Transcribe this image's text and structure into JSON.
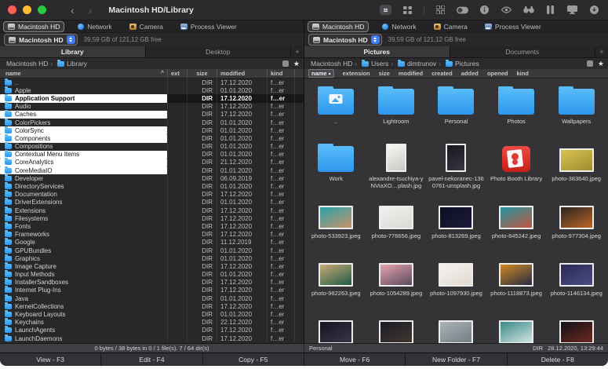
{
  "icons_legend": {
    "back": "‹",
    "forward": "›",
    "star": "★",
    "square": "view-square",
    "sort_caret_left": "^",
    "sort_arrow_right": "▴"
  },
  "colors": {
    "traffic_close": "#ff5f57",
    "traffic_min": "#febc2e",
    "traffic_zoom": "#28c840",
    "folder_blue": "#3da2f2",
    "accent_blue": "#3d7bf7",
    "selection_white": "#ffffff",
    "photobooth_red": "#d92722"
  },
  "titlebar": {
    "title": "Macintosh HD/Library"
  },
  "left_pane": {
    "tabs": [
      {
        "label": "Macintosh HD",
        "icon": "drive",
        "active": true
      },
      {
        "label": "Network",
        "icon": "globe"
      },
      {
        "label": "Camera",
        "icon": "camera"
      },
      {
        "label": "Process Viewer",
        "icon": "gauge"
      }
    ],
    "drive": {
      "name": "Macintosh HD",
      "free": "39,59 GB of 121,12 GB free"
    },
    "folder_tabs": [
      {
        "label": "Library",
        "active": true
      },
      {
        "label": "Desktop"
      }
    ],
    "add_tab_label": "+",
    "path": [
      {
        "label": "Macintosh HD",
        "icon": "drive"
      },
      {
        "label": "Library",
        "icon": "folder"
      }
    ],
    "columns": {
      "name": "name",
      "ext": "ext",
      "size": "size",
      "modified": "modified",
      "kind": "kind"
    },
    "sort_indicator": "^",
    "files": [
      {
        "name": "..",
        "ext": "",
        "size": "DIR",
        "modified": "17.12.2020",
        "kind": "f…er"
      },
      {
        "name": "Apple",
        "ext": "",
        "size": "DIR",
        "modified": "01.01.2020",
        "kind": "f…er"
      },
      {
        "name": "Application Support",
        "ext": "",
        "size": "DIR",
        "modified": "17.12.2020",
        "kind": "f…er",
        "selected": true,
        "cursor": true
      },
      {
        "name": "Audio",
        "ext": "",
        "size": "DIR",
        "modified": "17.12.2020",
        "kind": "f…er"
      },
      {
        "name": "Caches",
        "ext": "",
        "size": "DIR",
        "modified": "17.12.2020",
        "kind": "f…er",
        "selected": true
      },
      {
        "name": "ColorPickers",
        "ext": "",
        "size": "DIR",
        "modified": "01.01.2020",
        "kind": "f…er"
      },
      {
        "name": "ColorSync",
        "ext": "",
        "size": "DIR",
        "modified": "01.01.2020",
        "kind": "f…er",
        "selected": true
      },
      {
        "name": "Components",
        "ext": "",
        "size": "DIR",
        "modified": "01.01.2020",
        "kind": "f…er",
        "selected": true
      },
      {
        "name": "Compositions",
        "ext": "",
        "size": "DIR",
        "modified": "01.01.2020",
        "kind": "f…er"
      },
      {
        "name": "Contextual Menu Items",
        "ext": "",
        "size": "DIR",
        "modified": "01.01.2020",
        "kind": "f…er",
        "selected": true
      },
      {
        "name": "CoreAnalytics",
        "ext": "",
        "size": "DIR",
        "modified": "21.12.2020",
        "kind": "f…er",
        "selected": true
      },
      {
        "name": "CoreMediaIO",
        "ext": "",
        "size": "DIR",
        "modified": "01.01.2020",
        "kind": "f…er",
        "selected": true
      },
      {
        "name": "Developer",
        "ext": "",
        "size": "DIR",
        "modified": "06.09.2019",
        "kind": "f…er"
      },
      {
        "name": "DirectoryServices",
        "ext": "",
        "size": "DIR",
        "modified": "01.01.2020",
        "kind": "f…er"
      },
      {
        "name": "Documentation",
        "ext": "",
        "size": "DIR",
        "modified": "17.12.2020",
        "kind": "f…er"
      },
      {
        "name": "DriverExtensions",
        "ext": "",
        "size": "DIR",
        "modified": "01.01.2020",
        "kind": "f…er"
      },
      {
        "name": "Extensions",
        "ext": "",
        "size": "DIR",
        "modified": "17.12.2020",
        "kind": "f…er"
      },
      {
        "name": "Filesystems",
        "ext": "",
        "size": "DIR",
        "modified": "17.12.2020",
        "kind": "f…er"
      },
      {
        "name": "Fonts",
        "ext": "",
        "size": "DIR",
        "modified": "17.12.2020",
        "kind": "f…er"
      },
      {
        "name": "Frameworks",
        "ext": "",
        "size": "DIR",
        "modified": "17.12.2020",
        "kind": "f…er"
      },
      {
        "name": "Google",
        "ext": "",
        "size": "DIR",
        "modified": "11.12.2019",
        "kind": "f…er"
      },
      {
        "name": "GPUBundles",
        "ext": "",
        "size": "DIR",
        "modified": "01.01.2020",
        "kind": "f…er"
      },
      {
        "name": "Graphics",
        "ext": "",
        "size": "DIR",
        "modified": "01.01.2020",
        "kind": "f…er"
      },
      {
        "name": "Image Capture",
        "ext": "",
        "size": "DIR",
        "modified": "17.12.2020",
        "kind": "f…er"
      },
      {
        "name": "Input Methods",
        "ext": "",
        "size": "DIR",
        "modified": "01.01.2020",
        "kind": "f…er"
      },
      {
        "name": "InstallerSandboxes",
        "ext": "",
        "size": "DIR",
        "modified": "17.12.2020",
        "kind": "f…er"
      },
      {
        "name": "Internet Plug-Ins",
        "ext": "",
        "size": "DIR",
        "modified": "17.12.2020",
        "kind": "f…er"
      },
      {
        "name": "Java",
        "ext": "",
        "size": "DIR",
        "modified": "01.01.2020",
        "kind": "f…er"
      },
      {
        "name": "KernelCollections",
        "ext": "",
        "size": "DIR",
        "modified": "17.12.2020",
        "kind": "f…er"
      },
      {
        "name": "Keyboard Layouts",
        "ext": "",
        "size": "DIR",
        "modified": "01.01.2020",
        "kind": "f…er"
      },
      {
        "name": "Keychains",
        "ext": "",
        "size": "DIR",
        "modified": "22.12.2020",
        "kind": "f…er"
      },
      {
        "name": "LaunchAgents",
        "ext": "",
        "size": "DIR",
        "modified": "17.12.2020",
        "kind": "f…er"
      },
      {
        "name": "LaunchDaemons",
        "ext": "",
        "size": "DIR",
        "modified": "17.12.2020",
        "kind": "f…er"
      }
    ],
    "status": "0 bytes / 38 bytes in 0 / 1 file(s). 7 / 64 dir(s)"
  },
  "right_pane": {
    "tabs": [
      {
        "label": "Macintosh HD",
        "icon": "drive",
        "active": true
      },
      {
        "label": "Network",
        "icon": "globe"
      },
      {
        "label": "Camera",
        "icon": "camera"
      },
      {
        "label": "Process Viewer",
        "icon": "gauge"
      }
    ],
    "drive": {
      "name": "Macintosh HD",
      "free": "39,59 GB of 121,12 GB free"
    },
    "folder_tabs": [
      {
        "label": "Pictures",
        "active": true
      },
      {
        "label": "Documents"
      }
    ],
    "add_tab_label": "+",
    "path": [
      {
        "label": "Macintosh HD",
        "icon": "drive"
      },
      {
        "label": "Users",
        "icon": "folder"
      },
      {
        "label": "dimtrunov",
        "icon": "folder"
      },
      {
        "label": "Pictures",
        "icon": "folder"
      }
    ],
    "columns": [
      {
        "label": "name",
        "sorted": true,
        "arrow": "▴"
      },
      {
        "label": "extension"
      },
      {
        "label": "size"
      },
      {
        "label": "modified"
      },
      {
        "label": "created"
      },
      {
        "label": "added"
      },
      {
        "label": "opened"
      },
      {
        "label": "kind"
      }
    ],
    "items": [
      {
        "label": "..",
        "type": "updir"
      },
      {
        "label": "Lightroom",
        "type": "folder"
      },
      {
        "label": "Personal",
        "type": "folder"
      },
      {
        "label": "Photos",
        "type": "folder"
      },
      {
        "label": "Wallpapers",
        "type": "folder"
      },
      {
        "label": "Work",
        "type": "folder"
      },
      {
        "label": "alexandre-tsuchiya-yNViaXO…plash.jpg",
        "type": "image",
        "portrait": true,
        "thumb": [
          "#f7f7f4",
          "#c9c9c4"
        ]
      },
      {
        "label": "pavel-nekoranec-1360761-unsplash.jpg",
        "type": "image",
        "portrait": true,
        "thumb": [
          "#17171d",
          "#3a3542"
        ]
      },
      {
        "label": "Photo Booth Library",
        "type": "photobooth"
      },
      {
        "label": "photo-383640.jpeg",
        "type": "image",
        "thumb": [
          "#d9c250",
          "#a08c30"
        ]
      },
      {
        "label": "photo-533923.jpeg",
        "type": "image",
        "thumb": [
          "#2aa2aa",
          "#c79468"
        ]
      },
      {
        "label": "photo-776656.jpeg",
        "type": "image",
        "thumb": [
          "#f2f2f0",
          "#d8d8d4"
        ]
      },
      {
        "label": "photo-813269.jpeg",
        "type": "image",
        "thumb": [
          "#0d0d22",
          "#1d1d3c"
        ]
      },
      {
        "label": "photo-845242.jpeg",
        "type": "image",
        "thumb": [
          "#2496a5",
          "#c2543c"
        ]
      },
      {
        "label": "photo-977304.jpeg",
        "type": "image",
        "thumb": [
          "#2c2320",
          "#bc6628"
        ]
      },
      {
        "label": "photo-982263.jpeg",
        "type": "image",
        "thumb": [
          "#c8a878",
          "#1e5c44"
        ]
      },
      {
        "label": "photo-1054289.jpeg",
        "type": "image",
        "thumb": [
          "#e8a2ac",
          "#5a4a5e"
        ]
      },
      {
        "label": "photo-1097930.jpeg",
        "type": "image",
        "thumb": [
          "#f4f2ee",
          "#e2dad2"
        ]
      },
      {
        "label": "photo-1118873.jpeg",
        "type": "image",
        "thumb": [
          "#d08820",
          "#242c46"
        ]
      },
      {
        "label": "photo-1146134.jpeg",
        "type": "image",
        "thumb": [
          "#2a2a56",
          "#4c4c82"
        ]
      },
      {
        "label": "",
        "type": "image",
        "thumb": [
          "#14141e",
          "#36364a"
        ]
      },
      {
        "label": "",
        "type": "image",
        "thumb": [
          "#1a1a28",
          "#42382e"
        ]
      },
      {
        "label": "",
        "type": "image",
        "thumb": [
          "#aab4b8",
          "#747e82"
        ]
      },
      {
        "label": "",
        "type": "image",
        "thumb": [
          "#3a8a88",
          "#d0e4e0"
        ]
      },
      {
        "label": "",
        "type": "image",
        "thumb": [
          "#141018",
          "#6c2a20"
        ]
      }
    ],
    "status_name": "Personal",
    "status_size": "DIR",
    "status_modified": "28.12.2020, 13:29:44"
  },
  "function_bar": [
    {
      "label": "View - F3"
    },
    {
      "label": "Edit - F4"
    },
    {
      "label": "Copy - F5"
    },
    {
      "label": "Move - F6"
    },
    {
      "label": "New Folder - F7"
    },
    {
      "label": "Delete - F8"
    }
  ]
}
